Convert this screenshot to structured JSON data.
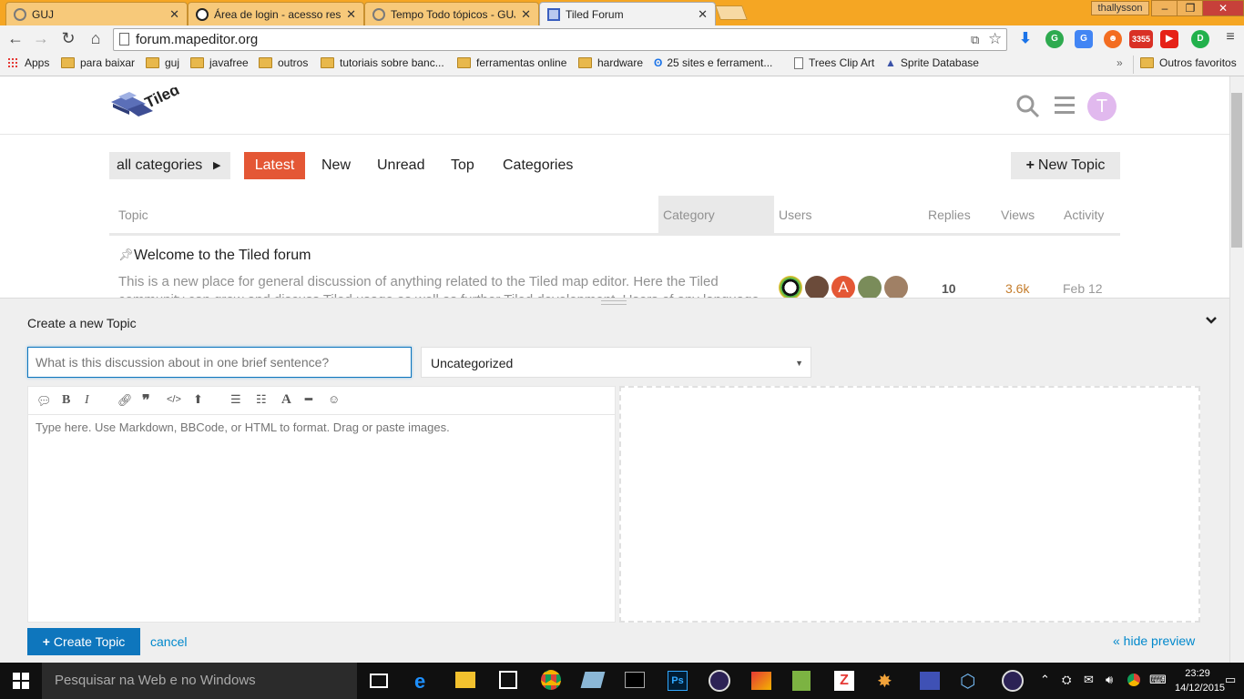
{
  "browser": {
    "tabs": [
      {
        "title": "GUJ",
        "active": false
      },
      {
        "title": "Área de login - acesso rest",
        "active": false
      },
      {
        "title": "Tempo Todo tópicos - GUJ",
        "active": false
      },
      {
        "title": "Tiled Forum",
        "active": true
      }
    ],
    "user_badge": "thallysson",
    "url": "forum.mapeditor.org",
    "bookmarks": [
      {
        "label": "Apps",
        "type": "apps"
      },
      {
        "label": "para baixar",
        "type": "folder"
      },
      {
        "label": "guj",
        "type": "folder"
      },
      {
        "label": "javafree",
        "type": "folder"
      },
      {
        "label": "outros",
        "type": "folder"
      },
      {
        "label": "tutoriais sobre banc...",
        "type": "folder"
      },
      {
        "label": "ferramentas online",
        "type": "folder"
      },
      {
        "label": "hardware",
        "type": "folder"
      },
      {
        "label": "25 sites e ferrament...",
        "type": "link"
      },
      {
        "label": "Trees Clip Art",
        "type": "page"
      },
      {
        "label": "Sprite Database",
        "type": "link"
      }
    ],
    "bookmarks_more": "»",
    "other_bookmarks": "Outros favoritos",
    "mail_count": "3355"
  },
  "forum": {
    "logo_text": "Tiled",
    "avatar_letter": "T",
    "nav": {
      "categories_dropdown": "all categories",
      "latest": "Latest",
      "new": "New",
      "unread": "Unread",
      "top": "Top",
      "categories": "Categories",
      "new_topic": "New Topic"
    },
    "table_headers": {
      "topic": "Topic",
      "category": "Category",
      "users": "Users",
      "replies": "Replies",
      "views": "Views",
      "activity": "Activity"
    },
    "topics": [
      {
        "title": "Welcome to the Tiled forum",
        "excerpt_line1": "This is a new place for general discussion of anything related to the Tiled map editor. Here the Tiled",
        "excerpt_line2": "community can grow and discuss Tiled usage as well as further Tiled development. Users of any language",
        "replies": "10",
        "views": "3.6k",
        "activity": "Feb 12",
        "avatar_letter": "A"
      }
    ]
  },
  "composer": {
    "title": "Create a new Topic",
    "title_placeholder": "What is this discussion about in one brief sentence?",
    "category": "Uncategorized",
    "body_placeholder": "Type here. Use Markdown, BBCode, or HTML to format. Drag or paste images.",
    "create_button": "Create Topic",
    "cancel": "cancel",
    "hide_preview": "« hide preview"
  },
  "taskbar": {
    "search_placeholder": "Pesquisar na Web e no Windows",
    "time": "23:29",
    "date": "14/12/2015"
  },
  "colors": {
    "accent": "#e45735",
    "link": "#0088cc",
    "button_blue": "#0e76bd",
    "chrome_orange": "#f5a623",
    "avatar_purple": "#e1b9ee"
  }
}
